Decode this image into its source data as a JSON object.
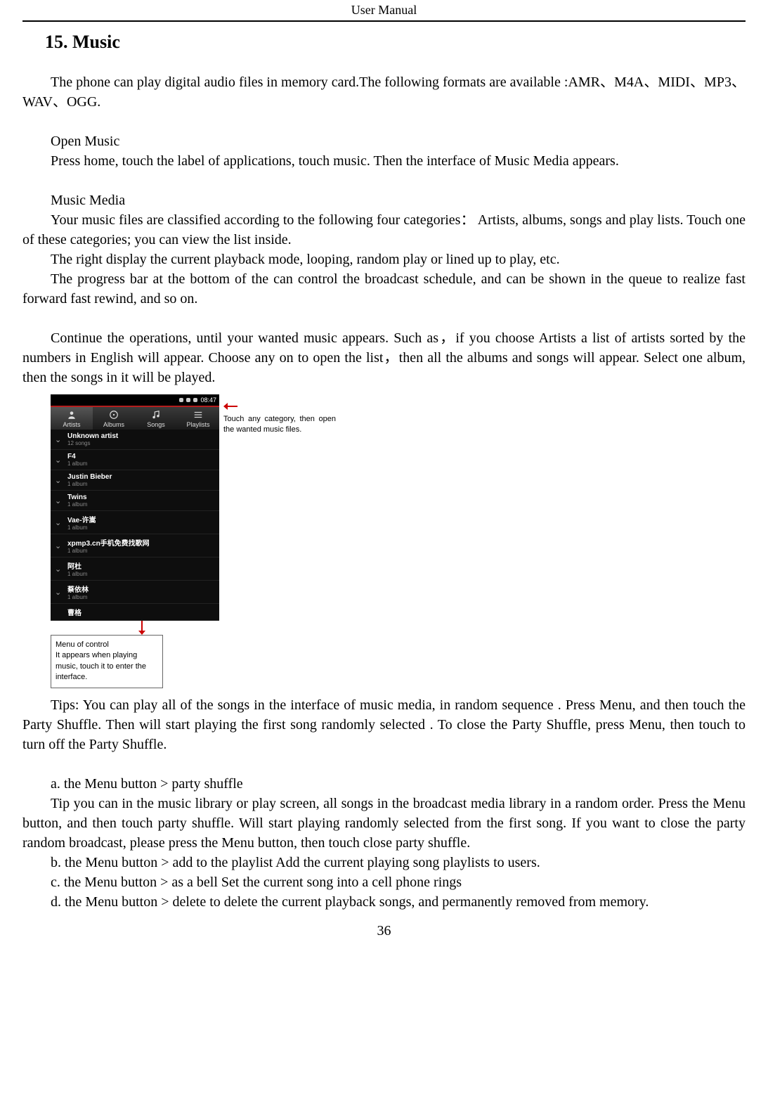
{
  "header": {
    "title": "User    Manual"
  },
  "section_title": "15. Music",
  "para_intro": "The    phone can play digital audio files in memory card.The following formats are available :AMR、M4A、MIDI、MP3、WAV、OGG.",
  "open_music": {
    "title": "Open Music",
    "body": "Press home, touch the label of applications, touch music. Then the interface of Music Media appears."
  },
  "music_media": {
    "title": "Music Media",
    "p1": "Your music files are classified according to the following four categories： Artists, albums, songs and play lists. Touch one of these categories; you can view the list inside.",
    "p2": "The right display the current playback mode, looping, random play or lined up to play, etc.",
    "p3": "The progress bar at the bottom of the can control the broadcast schedule, and can be shown in the queue to realize fast forward fast rewind, and so on."
  },
  "continue_para": "Continue the operations, until your wanted music appears. Such as，if you choose Artists a list of artists sorted by the numbers in English will appear. Choose any on to open the list，then all the albums and songs will appear. Select one album, then the songs in it will be played.",
  "figure": {
    "status_time": "08:47",
    "tabs": [
      {
        "label": "Artists",
        "active": true,
        "icon": "artists"
      },
      {
        "label": "Albums",
        "active": false,
        "icon": "albums"
      },
      {
        "label": "Songs",
        "active": false,
        "icon": "songs"
      },
      {
        "label": "Playlists",
        "active": false,
        "icon": "playlists"
      }
    ],
    "artists": [
      {
        "name": "Unknown artist",
        "sub": "12 songs"
      },
      {
        "name": "F4",
        "sub": "1 album"
      },
      {
        "name": "Justin Bieber",
        "sub": "1 album"
      },
      {
        "name": "Twins",
        "sub": "1 album"
      },
      {
        "name": "Vae-许嵩",
        "sub": "1 album"
      },
      {
        "name": "xpmp3.cn手机免费找歌网",
        "sub": "1 album"
      },
      {
        "name": "阿杜",
        "sub": "1 album"
      },
      {
        "name": "蔡依林",
        "sub": "1 album"
      },
      {
        "name": "曹格",
        "sub": ""
      }
    ],
    "callout_right": "Touch any category, then open the wanted music files.",
    "callout_bottom_title": "Menu of control",
    "callout_bottom_body": "It appears when playing music, touch it to enter the interface."
  },
  "tips": "Tips:     You can play all of the songs in the interface of    music media, in random sequence    . Press Menu, and then touch the Party Shuffle. Then will start playing the first song randomly selected . To close the Party Shuffle, press Menu, then touch to turn off the Party Shuffle.",
  "items": {
    "a_title": "a. the Menu button > party shuffle",
    "a_body": "Tip you can in the music library or play screen, all songs in the broadcast media library in a random order. Press the Menu button, and then touch party shuffle. Will start playing randomly selected from the first song. If you want to close the party random broadcast, please press the Menu button, then touch close party shuffle.",
    "b": "b. the Menu button > add to the playlist Add the current playing song playlists to users.",
    "c": "c. the Menu button > as a bell Set the current song into a cell phone rings",
    "d": "d.  the  Menu  button  >  delete  to  delete  the  current  playback  songs,  and  permanently  removed  from memory."
  },
  "page_number": "36"
}
